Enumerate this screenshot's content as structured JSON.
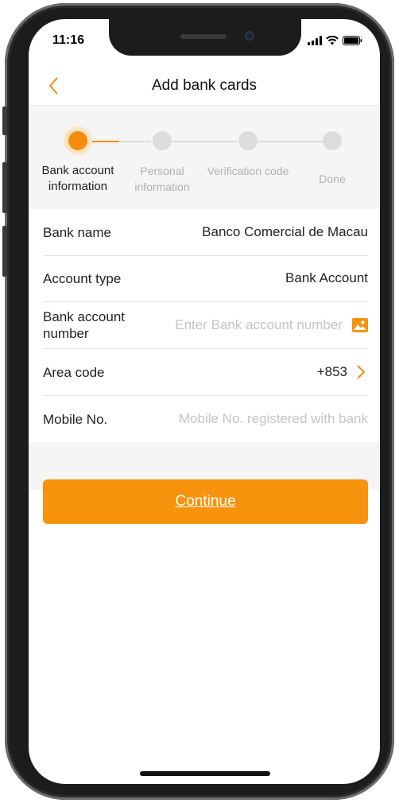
{
  "status_bar": {
    "time": "11:16"
  },
  "nav": {
    "title": "Add bank cards"
  },
  "steps": [
    {
      "label": "Bank account information",
      "active": true
    },
    {
      "label": "Personal information",
      "active": false
    },
    {
      "label": "Verification code",
      "active": false
    },
    {
      "label": "Done",
      "active": false
    }
  ],
  "form": {
    "bank_name": {
      "label": "Bank name",
      "value": "Banco Comercial de Macau"
    },
    "account_type": {
      "label": "Account type",
      "value": "Bank Account"
    },
    "account_number": {
      "label": "Bank account number",
      "placeholder": "Enter Bank account number"
    },
    "area_code": {
      "label": "Area code",
      "value": "+853"
    },
    "mobile": {
      "label": "Mobile No.",
      "placeholder": "Mobile No. registered with bank"
    }
  },
  "continue_label": "Continue",
  "colors": {
    "accent": "#f7930c",
    "accent_light": "#fde4c4",
    "inactive": "#dcdcdc",
    "background_gray": "#f5f5f5"
  },
  "icons": [
    "chevron-left-icon",
    "cellular-signal-icon",
    "wifi-icon",
    "battery-icon",
    "image-icon",
    "chevron-right-icon"
  ]
}
